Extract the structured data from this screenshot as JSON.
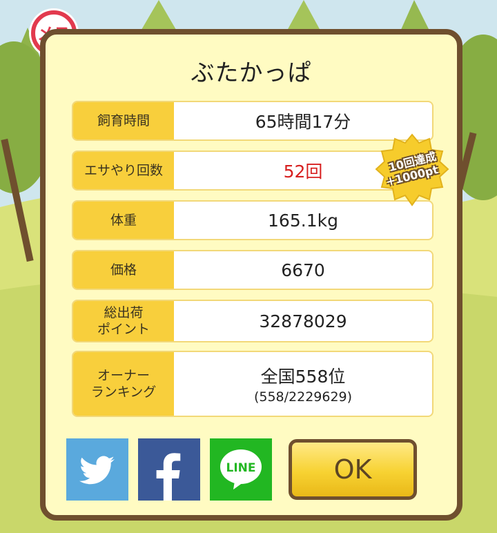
{
  "title": "ぶたかっぱ",
  "gender_badge": "メス",
  "rows": [
    {
      "label": "飼育時間",
      "value": "65時間17分"
    },
    {
      "label": "エサやり回数",
      "value": "52回"
    },
    {
      "label": "体重",
      "value": "165.1kg"
    },
    {
      "label": "価格",
      "value": "6670"
    },
    {
      "label": "総出荷\nポイント",
      "value": "32878029"
    },
    {
      "label": "オーナー\nランキング",
      "value": "全国558位",
      "sub": "(558/2229629)"
    }
  ],
  "achievement_badge": {
    "line1": "10回達成",
    "line2": "+1000pt"
  },
  "share": {
    "line_label": "LINE"
  },
  "ok_label": "OK",
  "colors": {
    "highlight": "#d71f1f",
    "label_bg": "#f8cf3c",
    "frame": "#6f4f2e"
  }
}
